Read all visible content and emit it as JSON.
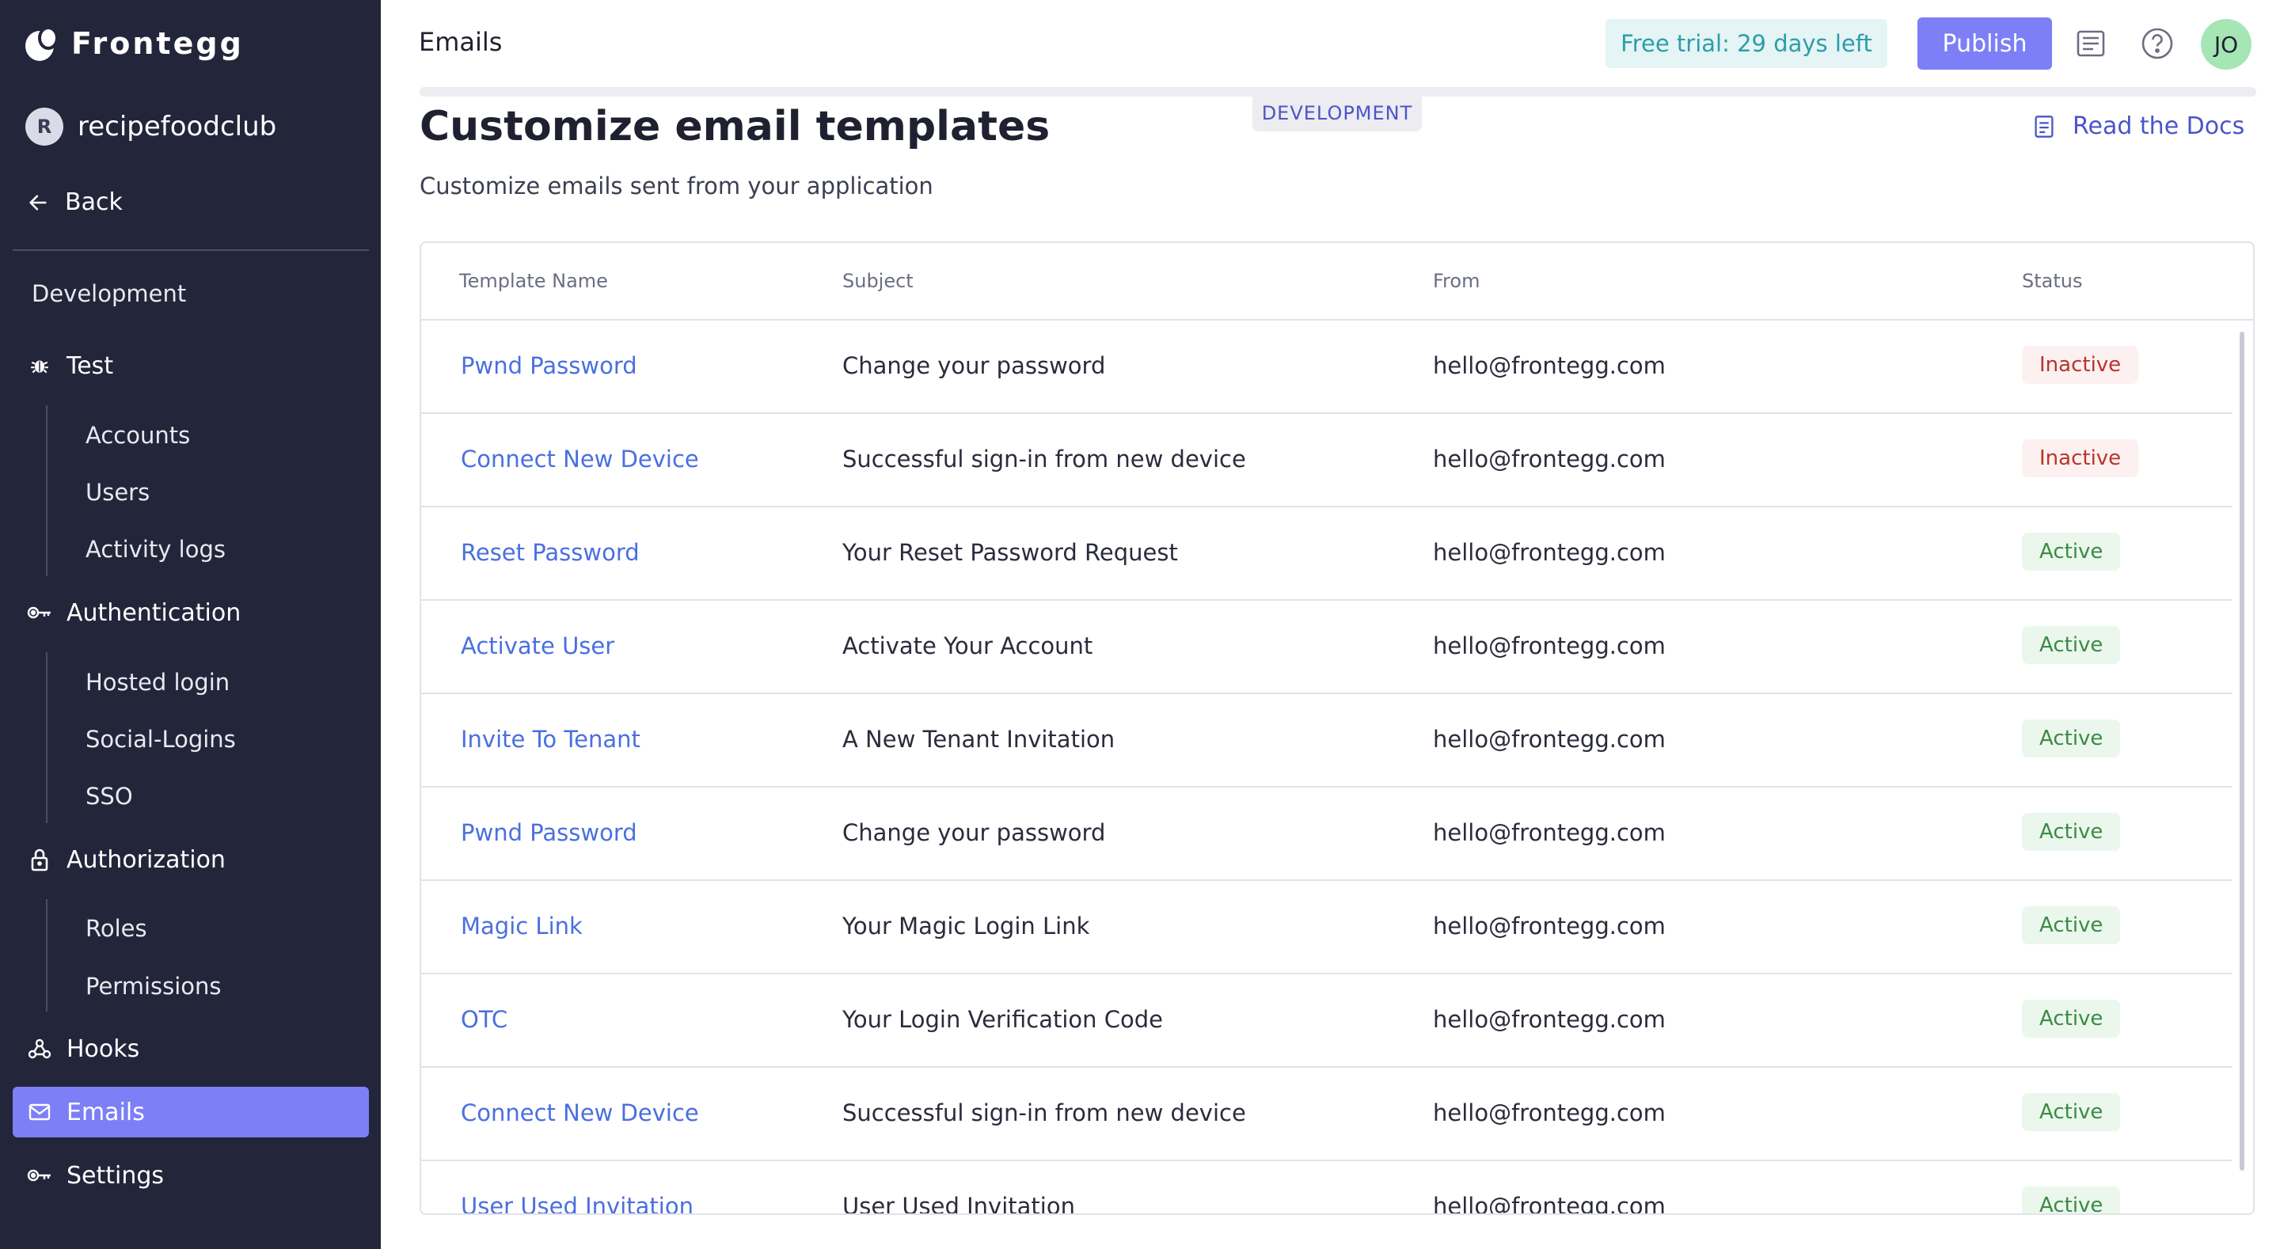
{
  "sidebar": {
    "logo_text": "Frontegg",
    "workspace_initial": "R",
    "workspace_name": "recipefoodclub",
    "back_label": "Back",
    "section_title": "Development",
    "test_label": "Test",
    "test_items": [
      "Accounts",
      "Users",
      "Activity logs"
    ],
    "authentication_label": "Authentication",
    "authentication_items": [
      "Hosted login",
      "Social-Logins",
      "SSO"
    ],
    "authorization_label": "Authorization",
    "authorization_items": [
      "Roles",
      "Permissions"
    ],
    "hooks_label": "Hooks",
    "emails_label": "Emails",
    "settings_label": "Settings"
  },
  "topbar": {
    "crumb": "Emails",
    "trial_label": "Free trial: 29 days left",
    "publish_label": "Publish",
    "user_initials": "JO"
  },
  "main": {
    "env_badge": "DEVELOPMENT",
    "title": "Customize email templates",
    "subtitle": "Customize emails sent from your application",
    "docs_label": "Read the Docs"
  },
  "table": {
    "headers": [
      "Template Name",
      "Subject",
      "From",
      "Status"
    ],
    "rows": [
      {
        "name": "Pwnd Password",
        "subject": "Change your password",
        "from": "hello@frontegg.com",
        "status": "Inactive"
      },
      {
        "name": "Connect New Device",
        "subject": "Successful sign-in from new device",
        "from": "hello@frontegg.com",
        "status": "Inactive"
      },
      {
        "name": "Reset Password",
        "subject": "Your Reset Password Request",
        "from": "hello@frontegg.com",
        "status": "Active"
      },
      {
        "name": "Activate User",
        "subject": "Activate Your Account",
        "from": "hello@frontegg.com",
        "status": "Active"
      },
      {
        "name": "Invite To Tenant",
        "subject": "A New Tenant Invitation",
        "from": "hello@frontegg.com",
        "status": "Active"
      },
      {
        "name": "Pwnd Password",
        "subject": "Change your password",
        "from": "hello@frontegg.com",
        "status": "Active"
      },
      {
        "name": "Magic Link",
        "subject": "Your Magic Login Link",
        "from": "hello@frontegg.com",
        "status": "Active"
      },
      {
        "name": "OTC",
        "subject": "Your Login Verification Code",
        "from": "hello@frontegg.com",
        "status": "Active"
      },
      {
        "name": "Connect New Device",
        "subject": "Successful sign-in from new device",
        "from": "hello@frontegg.com",
        "status": "Active"
      },
      {
        "name": "User Used Invitation",
        "subject": "User Used Invitation",
        "from": "hello@frontegg.com",
        "status": "Active"
      }
    ]
  },
  "icons": {
    "back": "arrow-left-icon",
    "test": "bug-icon",
    "authentication": "key-icon",
    "authorization": "lock-icon",
    "hooks": "webhook-icon",
    "emails": "mail-icon",
    "settings": "key-icon",
    "docs": "document-icon",
    "help": "help-circle-icon",
    "notes": "notes-icon"
  },
  "colors": {
    "sidebar_bg": "#23253a",
    "accent": "#7c7ff6",
    "link": "#4a6fe0",
    "inactive": "#b8342b",
    "active": "#3a8a45",
    "trial_text": "#2c9ea8"
  }
}
